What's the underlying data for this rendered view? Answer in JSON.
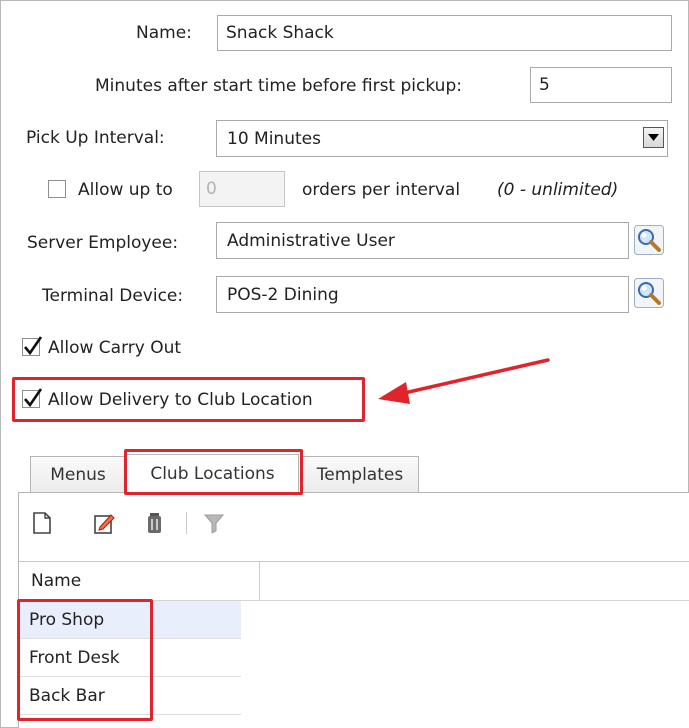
{
  "form": {
    "name_label": "Name:",
    "name_value": "Snack Shack",
    "minutes_label": "Minutes after start time before first pickup:",
    "minutes_value": "5",
    "interval_label": "Pick Up Interval:",
    "interval_value": "10 Minutes",
    "allow_up_to_label": "Allow up to",
    "allow_up_to_value": "0",
    "allow_up_to_checked": false,
    "orders_per_interval_label": "orders per interval",
    "unlimited_hint": "(0 - unlimited)",
    "server_label": "Server Employee:",
    "server_value": "Administrative User",
    "terminal_label": "Terminal Device:",
    "terminal_value": "POS-2 Dining",
    "carry_out_label": "Allow Carry Out",
    "carry_out_checked": true,
    "delivery_label": "Allow Delivery to Club Location",
    "delivery_checked": true
  },
  "tabs": [
    {
      "label": "Menus",
      "active": false
    },
    {
      "label": "Club Locations",
      "active": true
    },
    {
      "label": "Templates",
      "active": false
    }
  ],
  "toolbar": {
    "icons": [
      "new-icon",
      "edit-icon",
      "delete-icon",
      "filter-icon"
    ]
  },
  "grid": {
    "column_header": "Name",
    "rows": [
      "Pro Shop",
      "Front Desk",
      "Back Bar"
    ]
  },
  "colors": {
    "annotation_red": "#e0242c",
    "selected_row": "#e8eefb"
  }
}
